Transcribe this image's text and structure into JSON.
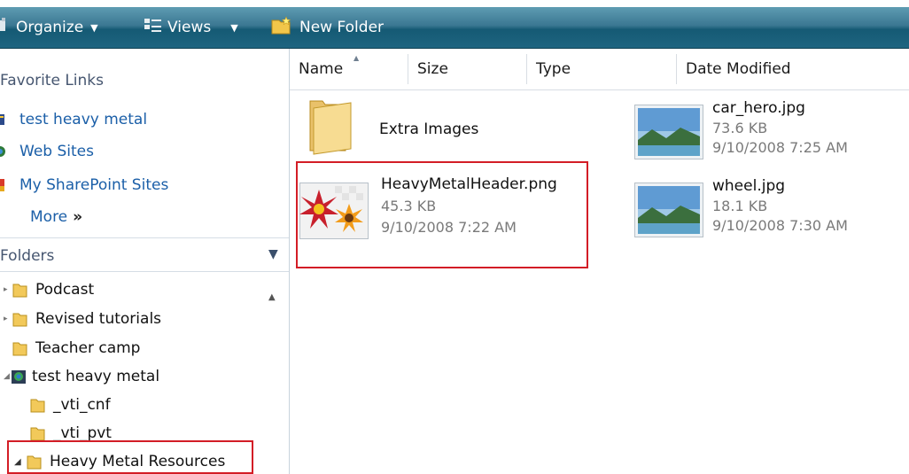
{
  "toolbar": {
    "organize_label": "Organize",
    "views_label": "Views",
    "new_folder_label": "New Folder"
  },
  "nav": {
    "favorites_title": "Favorite Links",
    "favorites": [
      {
        "label": "test heavy metal",
        "icon": "site-icon"
      },
      {
        "label": "Web Sites",
        "icon": "globe-icon"
      },
      {
        "label": "My SharePoint Sites",
        "icon": "sharepoint-icon"
      }
    ],
    "more_label": "More",
    "more_chevron": "»",
    "folders_title": "Folders",
    "tree": [
      {
        "label": "Podcast"
      },
      {
        "label": "Revised tutorials"
      },
      {
        "label": "Teacher camp"
      },
      {
        "label": "test heavy metal"
      },
      {
        "label": "_vti_cnf"
      },
      {
        "label": "_vti_pvt"
      },
      {
        "label": "Heavy Metal Resources"
      }
    ]
  },
  "columns": {
    "name": "Name",
    "size": "Size",
    "type": "Type",
    "date": "Date Modified"
  },
  "items": {
    "extra_images": {
      "name": "Extra Images"
    },
    "car_hero": {
      "name": "car_hero.jpg",
      "size": "73.6 KB",
      "date": "9/10/2008 7:25 AM"
    },
    "header_png": {
      "name": "HeavyMetalHeader.png",
      "size": "45.3 KB",
      "date": "9/10/2008 7:22 AM"
    },
    "wheel": {
      "name": "wheel.jpg",
      "size": "18.1 KB",
      "date": "9/10/2008 7:30 AM"
    }
  },
  "colors": {
    "highlight": "#d31d26",
    "link": "#1b5fa8",
    "toolbar": "#1e6480"
  }
}
